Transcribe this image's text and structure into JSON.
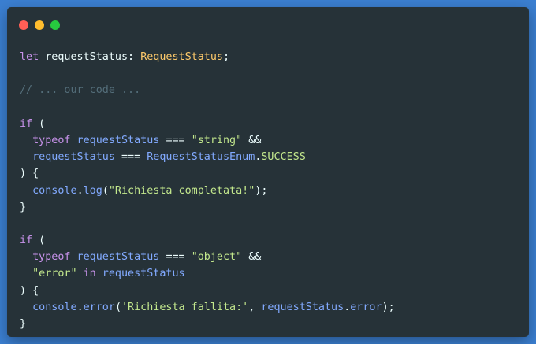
{
  "window": {
    "controls": [
      {
        "name": "close",
        "color": "#ff5f56"
      },
      {
        "name": "minimize",
        "color": "#ffbd2e"
      },
      {
        "name": "maximize",
        "color": "#27c93f"
      }
    ]
  },
  "code": {
    "lines": [
      [
        {
          "t": "let",
          "c": "kw"
        },
        {
          "t": " requestStatus: ",
          "c": "pl"
        },
        {
          "t": "RequestStatus",
          "c": "ty"
        },
        {
          "t": ";",
          "c": "pl"
        }
      ],
      [],
      [
        {
          "t": "// ... our code ...",
          "c": "cm"
        }
      ],
      [],
      [
        {
          "t": "if",
          "c": "kw"
        },
        {
          "t": " (",
          "c": "pl"
        }
      ],
      [
        {
          "t": "  ",
          "c": "pl"
        },
        {
          "t": "typeof",
          "c": "kw"
        },
        {
          "t": " requestStatus ",
          "c": "fn"
        },
        {
          "t": "===",
          "c": "pl"
        },
        {
          "t": " ",
          "c": "pl"
        },
        {
          "t": "\"string\"",
          "c": "st"
        },
        {
          "t": " &&",
          "c": "pl"
        }
      ],
      [
        {
          "t": "  requestStatus ",
          "c": "fn"
        },
        {
          "t": "===",
          "c": "pl"
        },
        {
          "t": " RequestStatusEnum",
          "c": "fn"
        },
        {
          "t": ".",
          "c": "pl"
        },
        {
          "t": "SUCCESS",
          "c": "st"
        }
      ],
      [
        {
          "t": ") {",
          "c": "pl"
        }
      ],
      [
        {
          "t": "  console",
          "c": "fn"
        },
        {
          "t": ".",
          "c": "pl"
        },
        {
          "t": "log",
          "c": "fn"
        },
        {
          "t": "(",
          "c": "pl"
        },
        {
          "t": "\"Richiesta completata!\"",
          "c": "st"
        },
        {
          "t": ");",
          "c": "pl"
        }
      ],
      [
        {
          "t": "}",
          "c": "pl"
        }
      ],
      [],
      [
        {
          "t": "if",
          "c": "kw"
        },
        {
          "t": " (",
          "c": "pl"
        }
      ],
      [
        {
          "t": "  ",
          "c": "pl"
        },
        {
          "t": "typeof",
          "c": "kw"
        },
        {
          "t": " requestStatus ",
          "c": "fn"
        },
        {
          "t": "===",
          "c": "pl"
        },
        {
          "t": " ",
          "c": "pl"
        },
        {
          "t": "\"object\"",
          "c": "st"
        },
        {
          "t": " &&",
          "c": "pl"
        }
      ],
      [
        {
          "t": "  ",
          "c": "pl"
        },
        {
          "t": "\"error\"",
          "c": "st"
        },
        {
          "t": " ",
          "c": "pl"
        },
        {
          "t": "in",
          "c": "kw"
        },
        {
          "t": " requestStatus",
          "c": "fn"
        }
      ],
      [
        {
          "t": ") {",
          "c": "pl"
        }
      ],
      [
        {
          "t": "  console",
          "c": "fn"
        },
        {
          "t": ".",
          "c": "pl"
        },
        {
          "t": "error",
          "c": "fn"
        },
        {
          "t": "(",
          "c": "pl"
        },
        {
          "t": "'Richiesta fallita:'",
          "c": "st"
        },
        {
          "t": ", ",
          "c": "pl"
        },
        {
          "t": "requestStatus",
          "c": "fn"
        },
        {
          "t": ".",
          "c": "pl"
        },
        {
          "t": "error",
          "c": "fn"
        },
        {
          "t": ");",
          "c": "pl"
        }
      ],
      [
        {
          "t": "}",
          "c": "pl"
        }
      ]
    ]
  }
}
